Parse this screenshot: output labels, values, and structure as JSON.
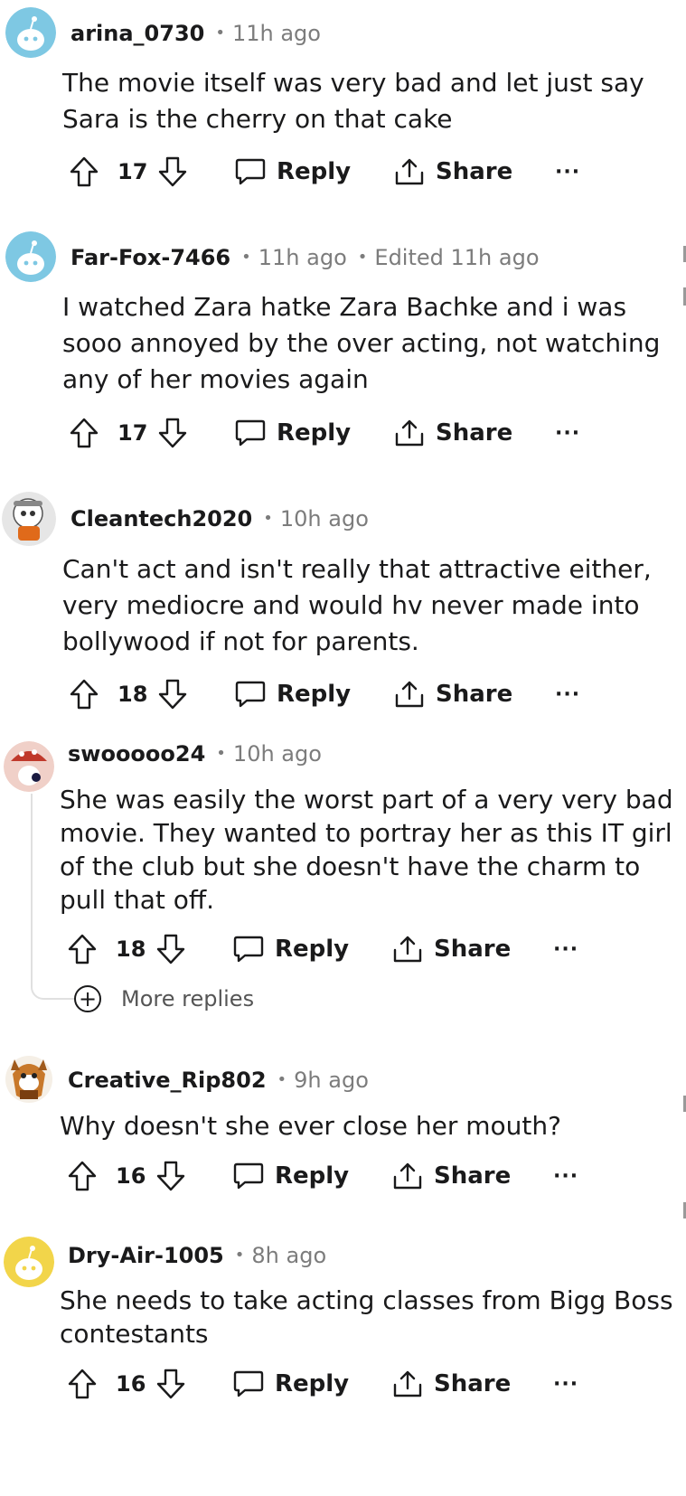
{
  "actions": {
    "reply_label": "Reply",
    "share_label": "Share",
    "more_label": "···"
  },
  "comments": [
    {
      "username": "arina_0730",
      "time": "11h ago",
      "edited": "",
      "lines": [
        "The movie itself was very bad and let just say",
        "Sara is the cherry on that cake"
      ],
      "votes": "17",
      "avatar_color": "#7ec8e3"
    },
    {
      "username": "Far-Fox-7466",
      "time": "11h ago",
      "edited": "Edited 11h ago",
      "lines": [
        "I watched Zara hatke Zara Bachke and i was",
        "sooo annoyed by the over acting, not watching",
        "any of her movies again"
      ],
      "votes": "17",
      "avatar_color": "#7ec8e3"
    },
    {
      "username": "Cleantech2020",
      "time": "10h ago",
      "edited": "",
      "lines": [
        "Can't act and isn't really that attractive either,",
        "very mediocre and would hv never made into",
        "bollywood if not for parents."
      ],
      "votes": "18",
      "avatar_color": "#e6e6e6"
    },
    {
      "username": "swooooo24",
      "time": "10h ago",
      "edited": "",
      "lines": [
        "She was easily the worst part of a very very bad",
        "movie. They wanted to portray her as this IT girl",
        "of the club but she doesn't have the charm to",
        "pull that off."
      ],
      "votes": "18",
      "avatar_color": "#f0d0c8"
    },
    {
      "username": "Creative_Rip802",
      "time": "9h ago",
      "edited": "",
      "lines": [
        "Why doesn't she ever close her mouth?"
      ],
      "votes": "16",
      "avatar_color": "#f5efe6"
    },
    {
      "username": "Dry-Air-1005",
      "time": "8h ago",
      "edited": "",
      "lines": [
        "She needs to take acting classes from Bigg Boss",
        "contestants"
      ],
      "votes": "16",
      "avatar_color": "#f2d54a"
    }
  ],
  "more_replies_label": "More replies"
}
